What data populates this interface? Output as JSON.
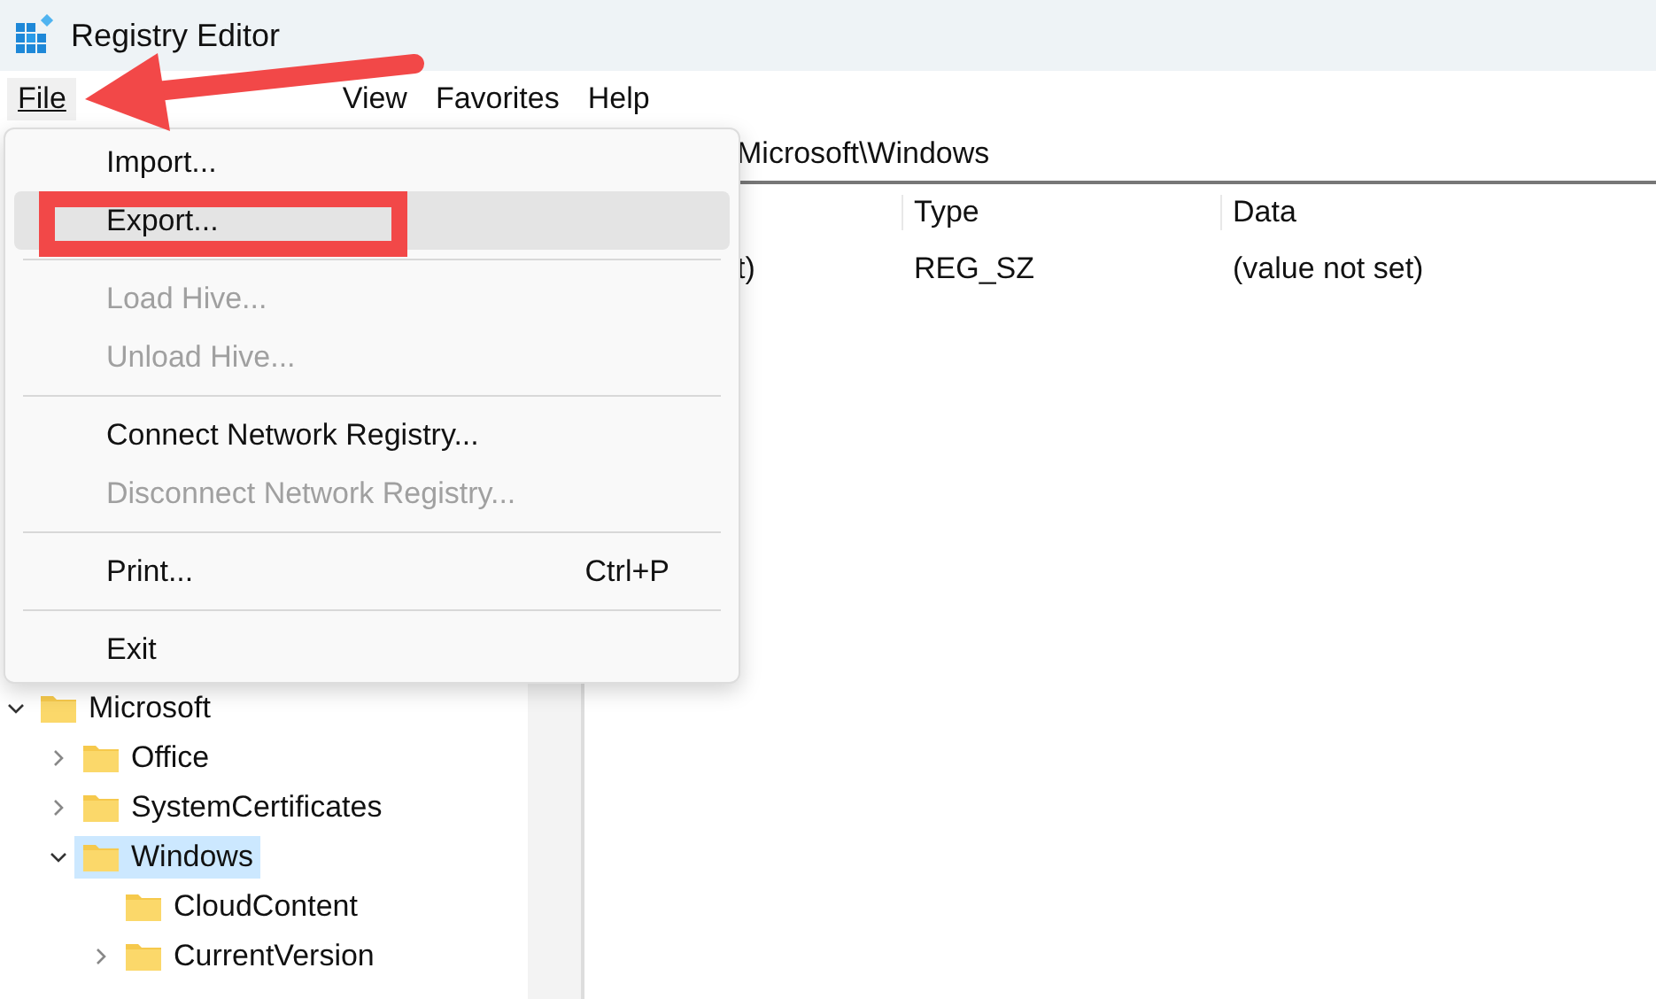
{
  "window": {
    "title": "Registry Editor"
  },
  "menu_bar": [
    {
      "label": "File",
      "selected": true
    },
    {
      "label": "View",
      "selected": false
    },
    {
      "label": "Favorites",
      "selected": false
    },
    {
      "label": "Help",
      "selected": false
    }
  ],
  "file_menu": [
    {
      "label": "Import...",
      "disabled": false,
      "highlighted": false,
      "separator_after": false
    },
    {
      "label": "Export...",
      "disabled": false,
      "highlighted": true,
      "separator_after": true
    },
    {
      "label": "Load Hive...",
      "disabled": true,
      "highlighted": false,
      "separator_after": false
    },
    {
      "label": "Unload Hive...",
      "disabled": true,
      "highlighted": false,
      "separator_after": true
    },
    {
      "label": "Connect Network Registry...",
      "disabled": false,
      "highlighted": false,
      "separator_after": false
    },
    {
      "label": "Disconnect Network Registry...",
      "disabled": true,
      "highlighted": false,
      "separator_after": true
    },
    {
      "label": "Print...",
      "shortcut": "Ctrl+P",
      "disabled": false,
      "highlighted": false,
      "separator_after": true
    },
    {
      "label": "Exit",
      "disabled": false,
      "highlighted": false,
      "separator_after": false
    }
  ],
  "address_bar": {
    "value": "Microsoft\\Windows"
  },
  "values_table": {
    "columns": [
      "Type",
      "Data"
    ],
    "rows": [
      {
        "name": "t)",
        "type": "REG_SZ",
        "data": "(value not set)"
      }
    ]
  },
  "tree": [
    {
      "label": "Microsoft",
      "expanded": true,
      "selected": false,
      "children": [
        {
          "label": "Office",
          "expanded": false,
          "selected": false,
          "has_children": true
        },
        {
          "label": "SystemCertificates",
          "expanded": false,
          "selected": false,
          "has_children": true
        },
        {
          "label": "Windows",
          "expanded": true,
          "selected": true,
          "children": [
            {
              "label": "CloudContent",
              "expanded": false,
              "selected": false,
              "has_children": false
            },
            {
              "label": "CurrentVersion",
              "expanded": false,
              "selected": false,
              "has_children": true
            }
          ]
        }
      ]
    }
  ]
}
